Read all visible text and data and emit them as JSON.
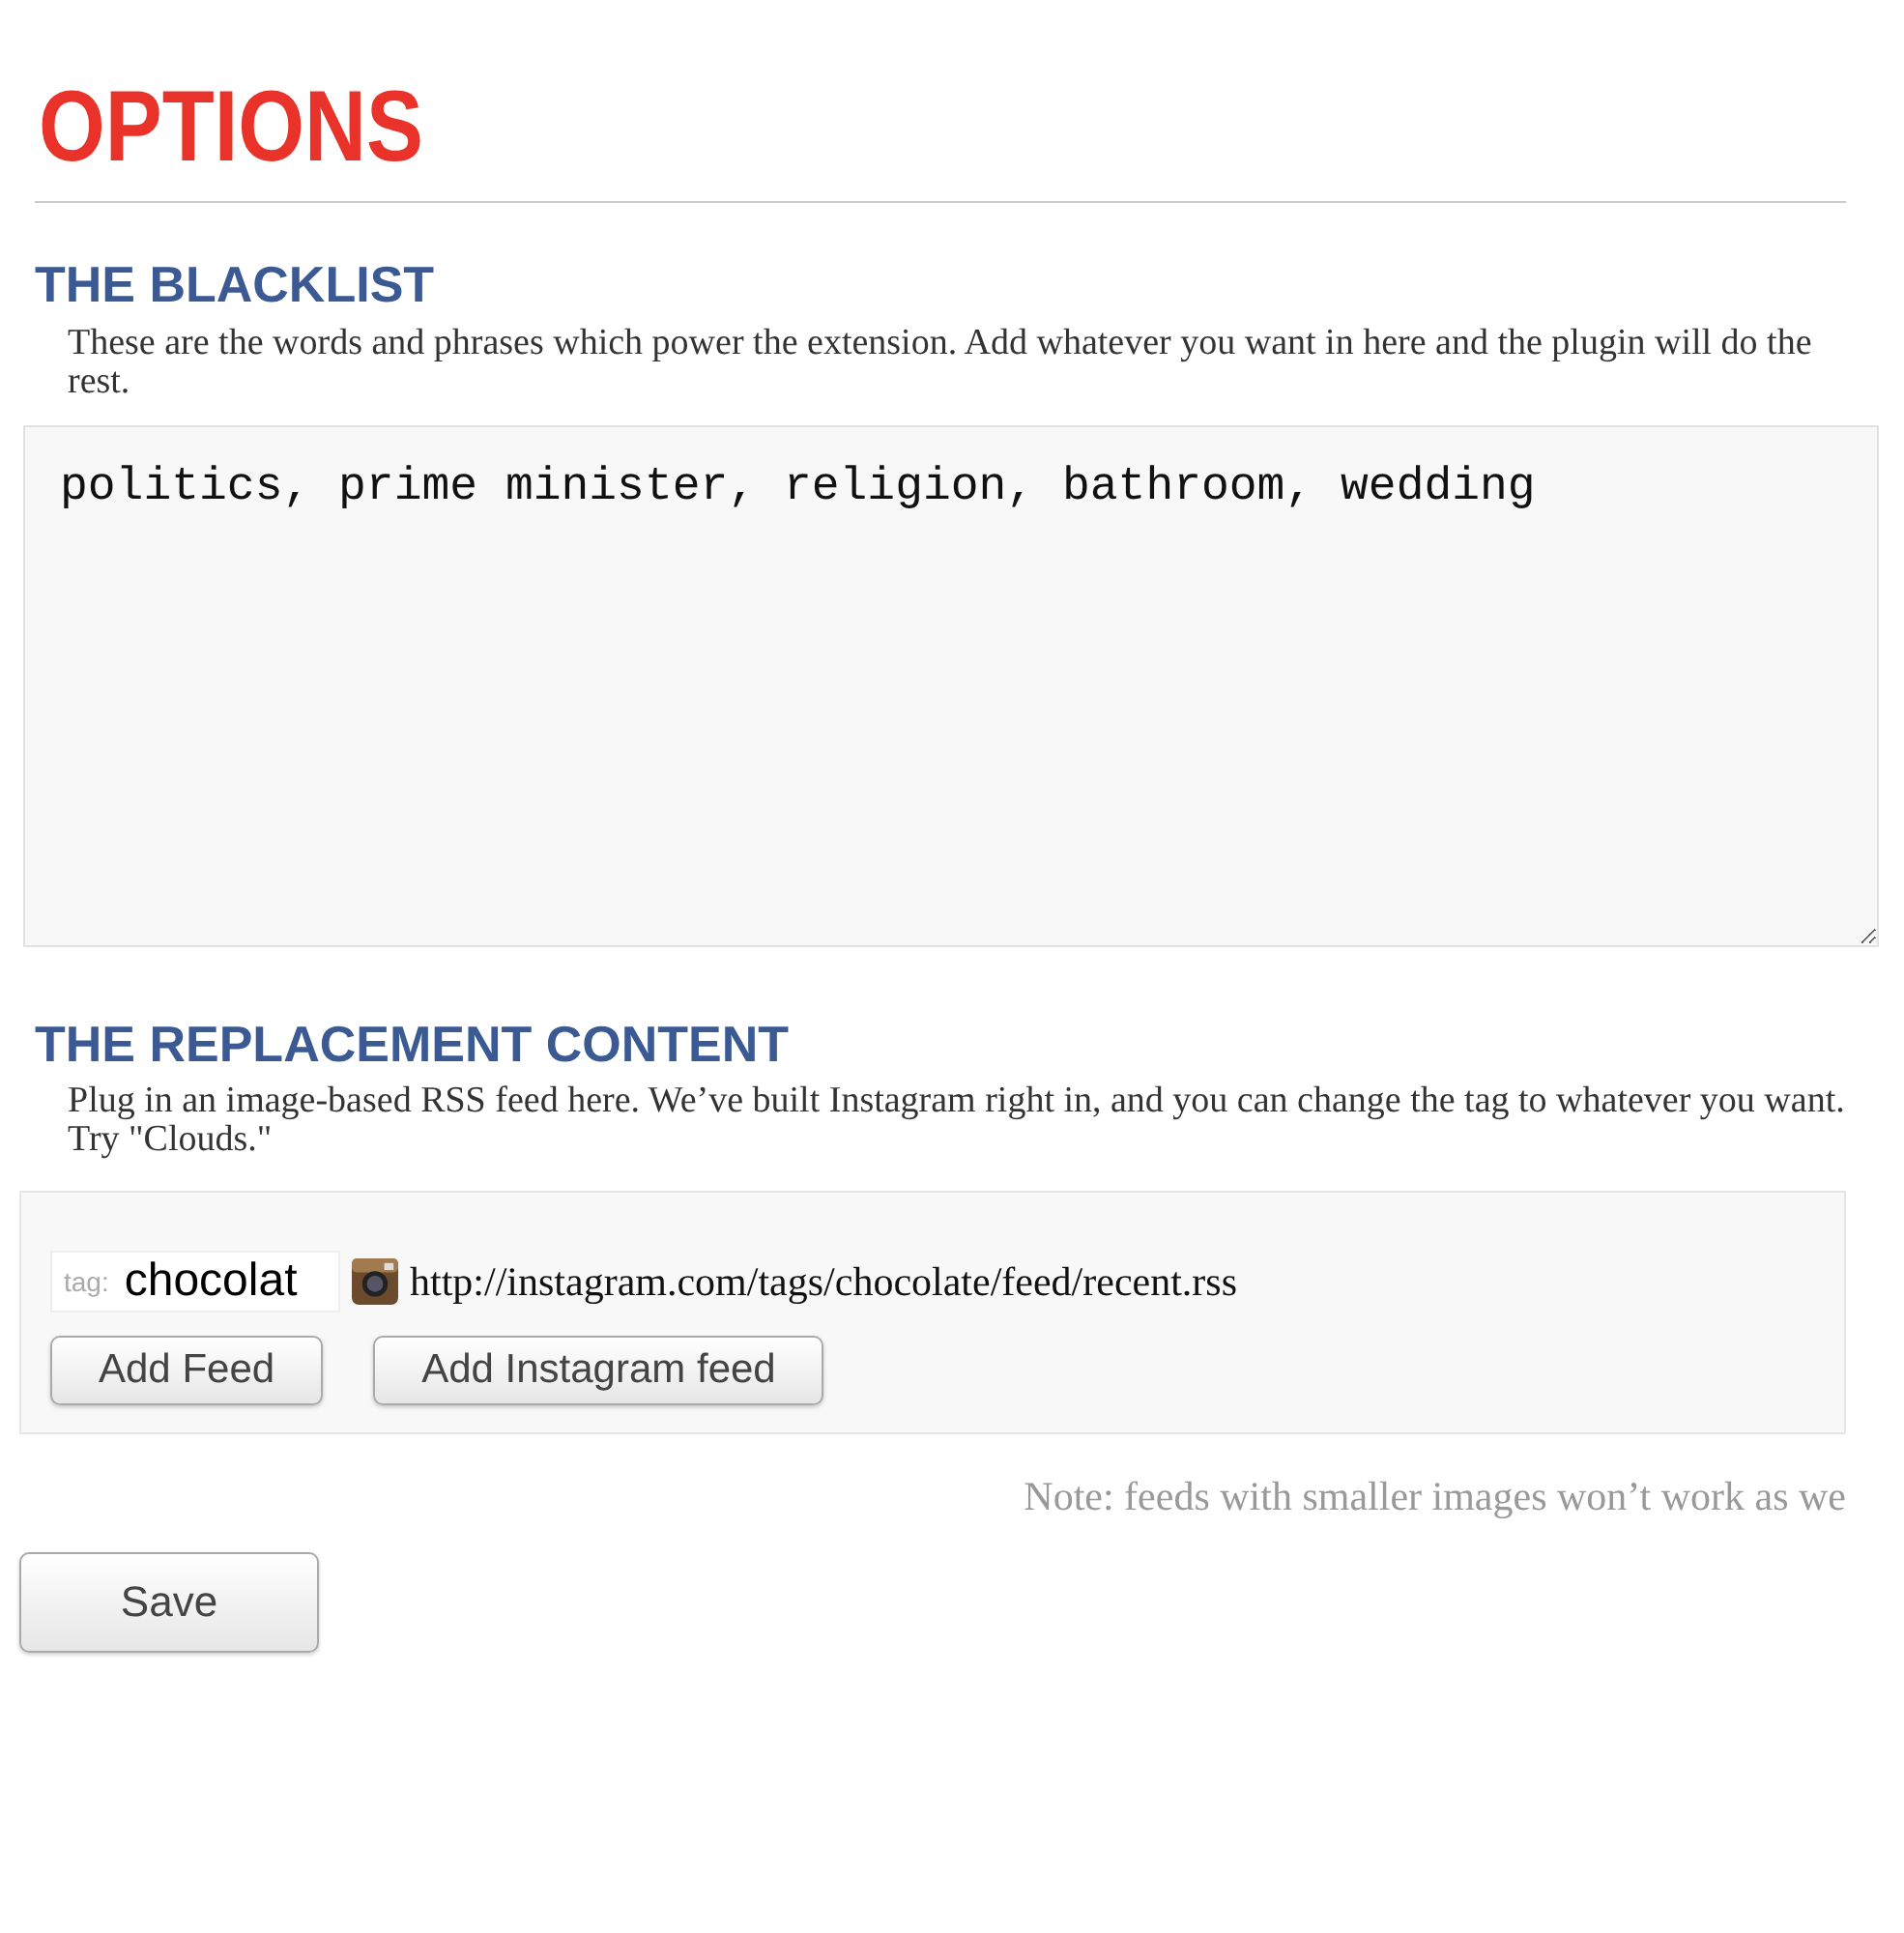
{
  "title": "OPTIONS",
  "blacklist": {
    "heading": "THE BLACKLIST",
    "description": "These are the words and phrases which power the extension. Add whatever you want in here and the plugin will do the rest.",
    "value": "politics, prime minister, religion, bathroom, wedding"
  },
  "replacement": {
    "heading": "THE REPLACEMENT CONTENT",
    "description": "Plug in an image-based RSS feed here. We’ve built Instagram right in, and you can change the tag to whatever you want. Try \"Clouds.\"",
    "tag_label": "tag:",
    "tag_value": "chocolat",
    "feed_url": "http://instagram.com/tags/chocolate/feed/recent.rss",
    "buttons": [
      "Add Feed",
      "Add Instagram feed"
    ],
    "note": "Note: feeds with smaller images won’t work as we"
  },
  "save_button": "Save"
}
